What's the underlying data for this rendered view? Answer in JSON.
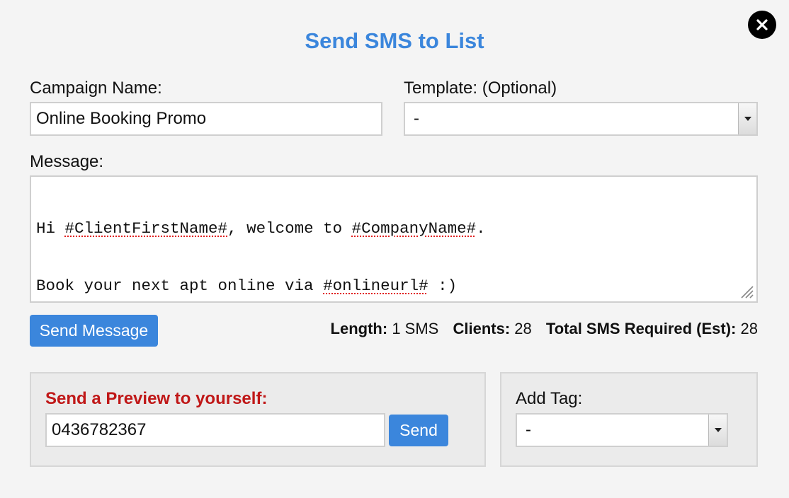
{
  "dialog": {
    "title": "Send SMS to List",
    "close_icon": "close-icon"
  },
  "form": {
    "campaign_name_label": "Campaign Name:",
    "campaign_name_value": "Online Booking Promo",
    "template_label": "Template: (Optional)",
    "template_value": "-",
    "message_label": "Message:",
    "message_lines": [
      "Hi #ClientFirstName#, welcome to #CompanyName#.",
      "Book your next apt online via #onlineurl# :)"
    ],
    "message_parts": {
      "line1_a": "Hi ",
      "line1_b": "#ClientFirstName#",
      "line1_c": ", welcome to ",
      "line1_d": "#CompanyName#",
      "line1_e": ".",
      "line2_a": "Book your next apt online via ",
      "line2_b": "#onlineurl#",
      "line2_c": " :)"
    }
  },
  "actions": {
    "send_message_label": "Send Message"
  },
  "stats": {
    "length_label": "Length:",
    "length_value": "1 SMS",
    "clients_label": "Clients:",
    "clients_value": "28",
    "total_label": "Total SMS Required (Est):",
    "total_value": "28"
  },
  "preview": {
    "label": "Send a Preview to yourself:",
    "phone_value": "0436782367",
    "send_label": "Send"
  },
  "tag": {
    "label": "Add Tag:",
    "value": "-"
  },
  "colors": {
    "accent": "#3b86dc",
    "preview_label": "#c01818",
    "background": "#f4f4f4"
  }
}
